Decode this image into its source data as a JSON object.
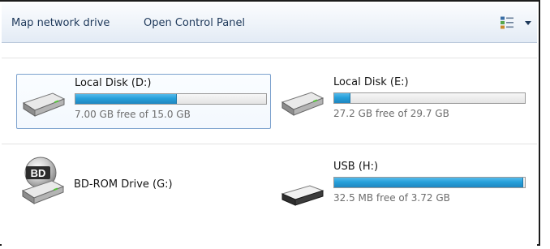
{
  "toolbar": {
    "map_network_drive": "Map network drive",
    "open_control_panel": "Open Control Panel"
  },
  "colors": {
    "bar_fill": "#26a0da",
    "selection_border": "#7da2ce",
    "link_text": "#1e395b"
  },
  "drives": [
    {
      "name": "Local Disk (D:)",
      "free_text": "7.00 GB free of 15.0 GB",
      "used_fraction": 0.533,
      "icon": "hard-drive-icon",
      "selected": true
    },
    {
      "name": "Local Disk (E:)",
      "free_text": "27.2 GB free of 29.7 GB",
      "used_fraction": 0.084,
      "icon": "hard-drive-icon",
      "selected": false
    },
    {
      "name": "BD-ROM Drive (G:)",
      "icon": "bd-rom-drive-icon",
      "badge": "BD",
      "selected": false
    },
    {
      "name": "USB (H:)",
      "free_text": "32.5 MB free of 3.72 GB",
      "used_fraction": 0.991,
      "icon": "usb-drive-icon",
      "selected": false
    }
  ]
}
